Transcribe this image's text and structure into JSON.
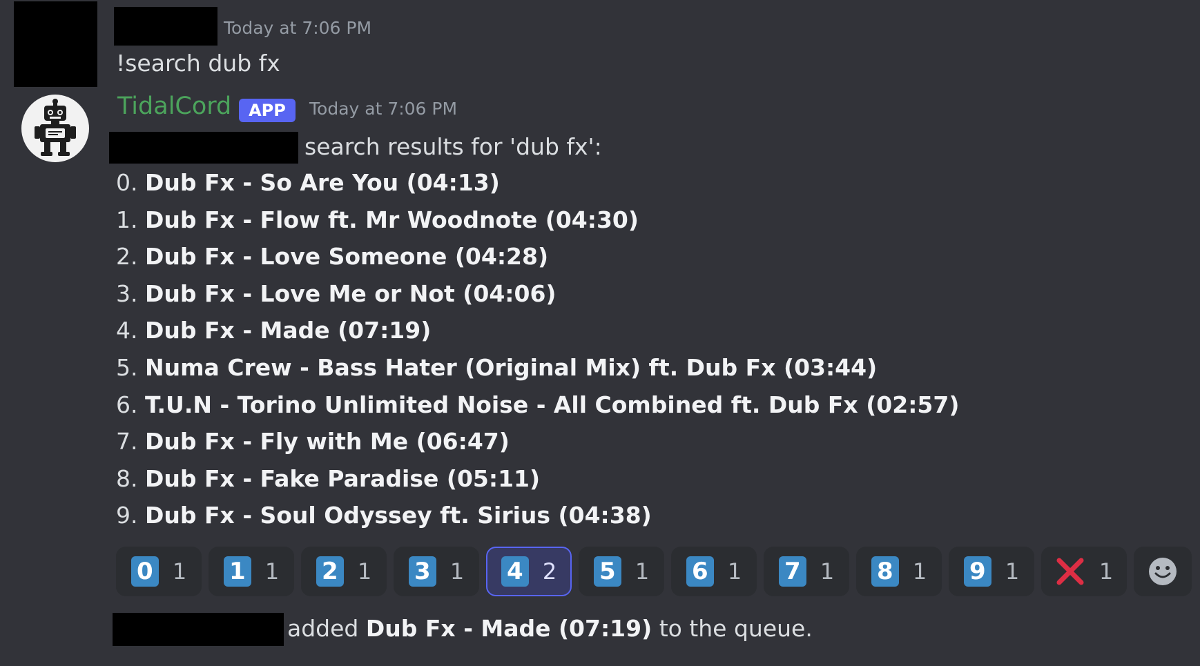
{
  "user_message": {
    "timestamp": "Today at 7:06 PM",
    "text": "!search dub fx"
  },
  "bot_message": {
    "username": "TidalCord",
    "badge": "APP",
    "timestamp": "Today at 7:06 PM",
    "header_text": "search results for 'dub fx':",
    "results": [
      {
        "num": "0.",
        "title": "Dub Fx - So Are You (04:13)"
      },
      {
        "num": "1.",
        "title": "Dub Fx - Flow ft. Mr Woodnote (04:30)"
      },
      {
        "num": "2.",
        "title": "Dub Fx - Love Someone (04:28)"
      },
      {
        "num": "3.",
        "title": "Dub Fx - Love Me or Not (04:06)"
      },
      {
        "num": "4.",
        "title": "Dub Fx - Made (07:19)"
      },
      {
        "num": "5.",
        "title": "Numa Crew - Bass Hater (Original Mix) ft. Dub Fx (03:44)"
      },
      {
        "num": "6.",
        "title": "T.U.N - Torino Unlimited Noise - All Combined ft. Dub Fx (02:57)"
      },
      {
        "num": "7.",
        "title": "Dub Fx - Fly with Me (06:47)"
      },
      {
        "num": "8.",
        "title": "Dub Fx - Fake Paradise (05:11)"
      },
      {
        "num": "9.",
        "title": "Dub Fx - Soul Odyssey ft. Sirius (04:38)"
      }
    ],
    "reactions": [
      {
        "emoji": "0",
        "count": "1",
        "active": false
      },
      {
        "emoji": "1",
        "count": "1",
        "active": false
      },
      {
        "emoji": "2",
        "count": "1",
        "active": false
      },
      {
        "emoji": "3",
        "count": "1",
        "active": false
      },
      {
        "emoji": "4",
        "count": "2",
        "active": true
      },
      {
        "emoji": "5",
        "count": "1",
        "active": false
      },
      {
        "emoji": "6",
        "count": "1",
        "active": false
      },
      {
        "emoji": "7",
        "count": "1",
        "active": false
      },
      {
        "emoji": "8",
        "count": "1",
        "active": false
      },
      {
        "emoji": "9",
        "count": "1",
        "active": false
      },
      {
        "emoji": "cross-mark-icon",
        "count": "1",
        "active": false
      }
    ],
    "add_reaction_icon": "smiley-face-icon",
    "avatar_icon": "robot-icon"
  },
  "queue_message": {
    "prefix": "added",
    "track": "Dub Fx - Made (07:19)",
    "suffix": "to the queue."
  },
  "colors": {
    "background": "#323339",
    "username": "#4ca45c",
    "app_badge": "#5865f2",
    "keycap": "#3b88c3",
    "cross": "#dd2e44"
  }
}
